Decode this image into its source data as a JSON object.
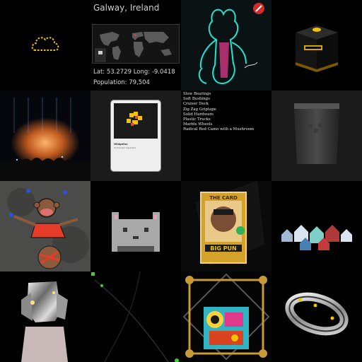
{
  "gallery": {
    "tiles": [
      {
        "kind": "icon",
        "icon": "dotted-cloud-outline-icon"
      },
      {
        "kind": "map",
        "city": "Galway, Ireland",
        "coords": "Lat: 53.2729 Long: -9.0418",
        "population": "Population: 79,504"
      },
      {
        "kind": "art",
        "icon": "neon-creature-art"
      },
      {
        "kind": "art",
        "icon": "black-box-button-art"
      },
      {
        "kind": "art",
        "icon": "concert-crowd-photo"
      },
      {
        "kind": "card",
        "icon": "pixel-card-art",
        "card_title": "Hildgefon",
        "card_sub": "Unrevealed Ingredient"
      },
      {
        "kind": "list",
        "items": [
          "Slow Bearings",
          "Soft Bushings",
          "Cruiser Deck",
          "Zig Zag Griptape",
          "Solid Hardware",
          "Plastic Trucks",
          "Marble Wheels",
          "Radical Red Camo with a Mushroom"
        ]
      },
      {
        "kind": "art",
        "icon": "sealed-bag-art"
      },
      {
        "kind": "art",
        "icon": "monkey-drawing-art"
      },
      {
        "kind": "art",
        "icon": "pixel-cat-art"
      },
      {
        "kind": "art",
        "icon": "big-pun-card-art",
        "card_top": "THE CARD",
        "card_name": "BIG PUN"
      },
      {
        "kind": "art",
        "icon": "crystal-houses-art"
      },
      {
        "kind": "art",
        "icon": "chrome-robot-art"
      },
      {
        "kind": "art",
        "icon": "orbit-lines-art"
      },
      {
        "kind": "art",
        "icon": "framed-robot-art"
      },
      {
        "kind": "art",
        "icon": "silver-ring-art"
      }
    ]
  },
  "colors": {
    "accent_yellow": "#f2c200",
    "neon_cyan": "#1ee6d2",
    "neon_pink": "#e0388a",
    "green_dot": "#3fd12b"
  }
}
